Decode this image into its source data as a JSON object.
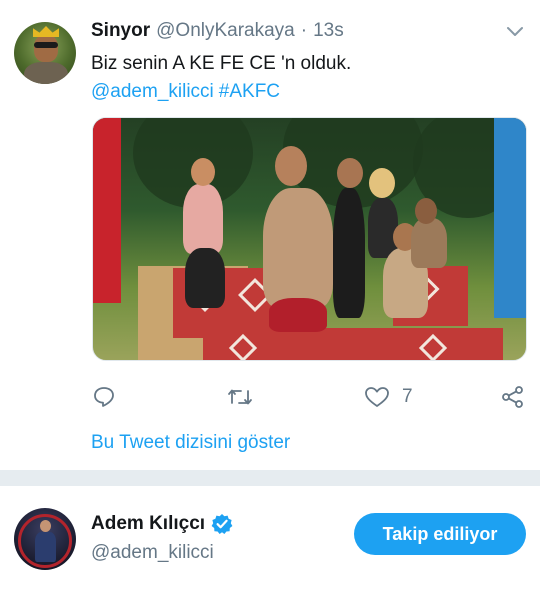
{
  "tweet": {
    "author_name": "Sinyor",
    "author_handle": "@OnlyKarakaya",
    "separator": "·",
    "time": "13s",
    "text": "Biz senin A KE FE CE 'n olduk.",
    "mention": "@adem_kilicci",
    "hashtag": "#AKFC",
    "like_count": "7",
    "show_thread": "Bu Tweet dizisini göster",
    "icons": [
      "chevron-down-icon",
      "reply-icon",
      "retweet-icon",
      "like-icon",
      "share-icon"
    ]
  },
  "follow_card": {
    "name": "Adem Kılıçcı",
    "handle": "@adem_kilicci",
    "verified_icon": "verified-badge-icon",
    "button_label": "Takip ediliyor"
  },
  "colors": {
    "accent": "#1da1f2",
    "secondary_text": "#657786",
    "primary_text": "#14171a",
    "separator": "#e6ecf0"
  }
}
